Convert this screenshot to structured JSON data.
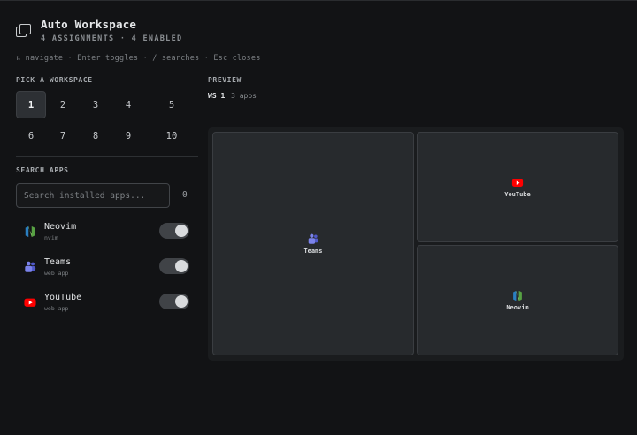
{
  "header": {
    "title": "Auto Workspace",
    "subtitle": "4 ASSIGNMENTS · 4 ENABLED",
    "icon": "windows-icon"
  },
  "hints": "⇅ navigate · Enter toggles · / searches · Esc closes",
  "workspace_picker": {
    "label": "PICK A WORKSPACE",
    "selected": "1",
    "items": [
      "1",
      "2",
      "3",
      "4",
      "5",
      "6",
      "7",
      "8",
      "9",
      "10"
    ]
  },
  "search": {
    "label": "SEARCH APPS",
    "placeholder": "Search installed apps...",
    "value": "",
    "count": "0"
  },
  "apps": [
    {
      "name": "Neovim",
      "sub": "nvim",
      "icon": "neovim-icon",
      "enabled": true
    },
    {
      "name": "Teams",
      "sub": "web app",
      "icon": "teams-icon",
      "enabled": true
    },
    {
      "name": "YouTube",
      "sub": "web app",
      "icon": "youtube-icon",
      "enabled": true
    }
  ],
  "preview": {
    "label": "PREVIEW",
    "ws": "WS 1",
    "app_count": "3 apps",
    "tiles": [
      {
        "name": "Teams",
        "icon": "teams-icon"
      },
      {
        "name": "YouTube",
        "icon": "youtube-icon"
      },
      {
        "name": "Neovim",
        "icon": "neovim-icon"
      }
    ]
  },
  "colors": {
    "background": "#121315",
    "youtube_red": "#ff0000",
    "teams_purple": "#7b83eb",
    "neovim_green": "#57a143",
    "neovim_blue": "#2a7fc1"
  }
}
